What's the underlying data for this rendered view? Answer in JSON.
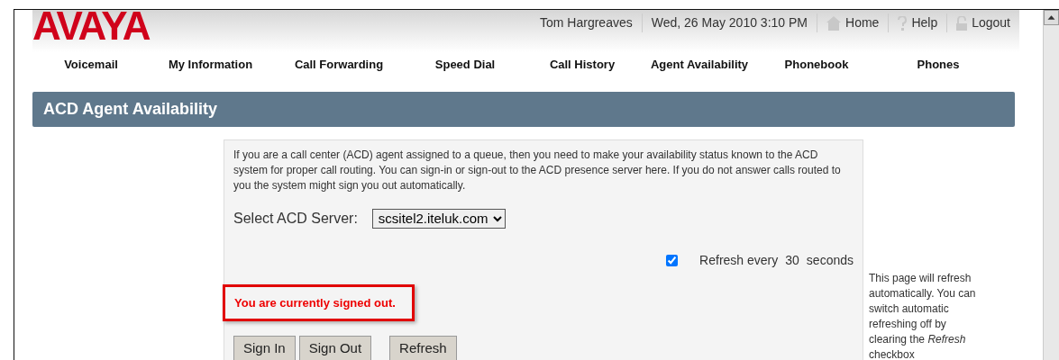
{
  "header": {
    "logo": "AVAYA",
    "user": "Tom Hargreaves",
    "datetime": "Wed, 26 May 2010 3:10 PM",
    "links": [
      {
        "kind": "home",
        "label": "Home"
      },
      {
        "kind": "help",
        "label": "Help"
      },
      {
        "kind": "logout",
        "label": "Logout"
      }
    ]
  },
  "nav": [
    {
      "label": "Voicemail"
    },
    {
      "label": "My Information"
    },
    {
      "label": "Call Forwarding"
    },
    {
      "label": "Speed Dial"
    },
    {
      "label": "Call History"
    },
    {
      "label": "Agent Availability"
    },
    {
      "label": "Phonebook"
    },
    {
      "label": "Phones"
    }
  ],
  "page_title": "ACD Agent Availability",
  "intro": "If you are a call center (ACD) agent assigned to a queue, then you need to make your availability status known to the ACD system for proper call routing. You can sign-in or sign-out to the ACD presence server here. If you do not answer calls routed to you the system might sign you out automatically.",
  "server": {
    "label": "Select ACD Server:",
    "value": "scsitel2.iteluk.com"
  },
  "refresh": {
    "checked": true,
    "label": "Refresh every",
    "interval": "30",
    "unit": "seconds"
  },
  "status": "You are currently signed out.",
  "buttons": [
    "Sign In",
    "Sign Out",
    "Refresh"
  ],
  "help_note": "This page will refresh automatically. You can switch automatic refreshing off by clearing the *Refresh* checkbox"
}
